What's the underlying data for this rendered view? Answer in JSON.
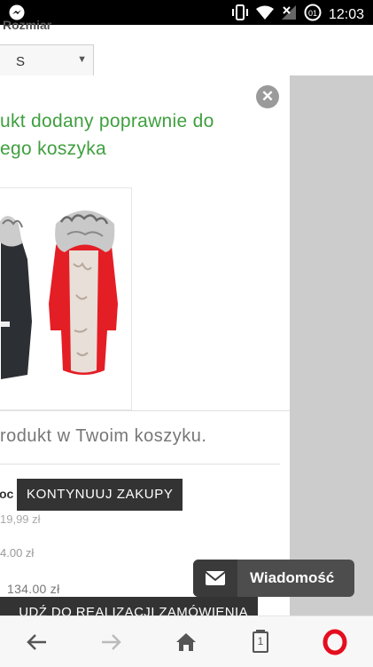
{
  "status_bar": {
    "time": "12:03",
    "icons": [
      "messenger-icon",
      "vibrate-icon",
      "wifi-icon",
      "no-signal-icon",
      "data-saver-icon"
    ]
  },
  "page": {
    "size_label": "Rozmiar",
    "size_value": "S"
  },
  "modal": {
    "title_line1": "ukt dodany poprawnie do",
    "title_line2": "ego koszyka",
    "cart_info": "rodukt w Twoim koszyku.",
    "summary_label": "oc",
    "price_partial_1": "19,99 zł",
    "price_partial_2": "4.00 zł",
    "total_price": "134.00 zł",
    "continue_button": "KONTYNUUJ ZAKUPY",
    "checkout_button": "UDŹ DO REALIZACJI ZAMÓWIENIA",
    "colors": {
      "title": "#3f9f3f",
      "button": "#333333",
      "overlay": "#cccccc"
    }
  },
  "message_widget": {
    "label": "Wiadomość",
    "icon": "mail-icon"
  },
  "bottom_nav": {
    "tab_count": "1",
    "items": [
      "back-arrow-icon",
      "forward-arrow-icon",
      "home-icon",
      "tabs-icon",
      "opera-icon"
    ],
    "brand_color": "#e40e1e"
  }
}
